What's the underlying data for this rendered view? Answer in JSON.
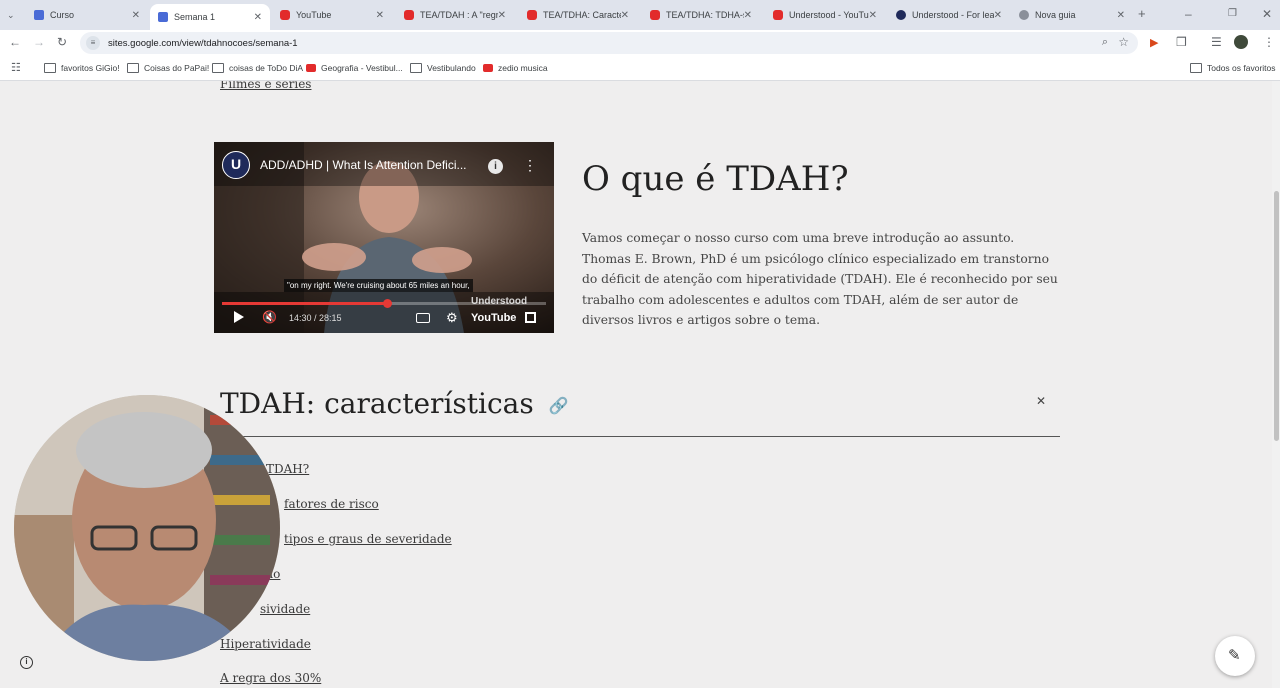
{
  "tabs": [
    {
      "title": "Curso",
      "icon": "google-sites-icon",
      "active": false
    },
    {
      "title": "Semana 1",
      "icon": "google-sites-icon",
      "active": true
    },
    {
      "title": "YouTube",
      "icon": "youtube-icon",
      "active": false
    },
    {
      "title": "TEA/TDAH : A \"regra",
      "icon": "youtube-icon",
      "active": false
    },
    {
      "title": "TEA/TDHA: Caracterís",
      "icon": "youtube-icon",
      "active": false
    },
    {
      "title": "TEA/TDHA: TDHA-sub",
      "icon": "youtube-icon",
      "active": false
    },
    {
      "title": "Understood - YouTub",
      "icon": "youtube-icon",
      "active": false
    },
    {
      "title": "Understood - For lea",
      "icon": "understood-icon",
      "active": false
    },
    {
      "title": "Nova guia",
      "icon": "globe-icon",
      "active": false
    }
  ],
  "address": {
    "url": "sites.google.com/view/tdahnocoes/semana-1"
  },
  "bookmarks": [
    {
      "label": "favoritos GiGio!",
      "icon": "folder-icon"
    },
    {
      "label": "Coisas do PaPai!",
      "icon": "folder-icon"
    },
    {
      "label": "coisas de ToDo DiA",
      "icon": "folder-icon"
    },
    {
      "label": "Geografia - Vestibul...",
      "icon": "youtube-icon"
    },
    {
      "label": "Vestibulando",
      "icon": "folder-icon"
    },
    {
      "label": "zedio musica",
      "icon": "youtube-icon"
    }
  ],
  "all_bookmarks": "Todos os favoritos",
  "top_link": "Filmes e séries",
  "video": {
    "title": "ADD/ADHD | What Is Attention Defici...",
    "caption": "\"on my right. We're cruising about 65 miles an hour,",
    "time": "14:30 / 28:15",
    "watermark": "Understood",
    "progress_fraction": 0.51
  },
  "section1": {
    "title": "O que é TDAH?",
    "body": "Vamos começar o nosso curso com uma breve introdução ao assunto. Thomas E. Brown, PhD é um psicólogo clínico especializado em transtorno do déficit de atenção com hiperatividade (TDAH). Ele é reconhecido por seu trabalho com adolescentes e adultos com TDAH, além de ser autor de diversos livros e artigos sobre o tema."
  },
  "section2": {
    "title": "TDAH: características",
    "links": [
      "TDAH?",
      "fatores de risco",
      "tipos e graus de severidade",
      "ão",
      "sividade",
      "Hiperatividade",
      "A regra dos 30%"
    ]
  },
  "colors": {
    "accent": "#e53935",
    "page_bg": "#efeeee",
    "tabstrip": "#dfe3ec"
  }
}
